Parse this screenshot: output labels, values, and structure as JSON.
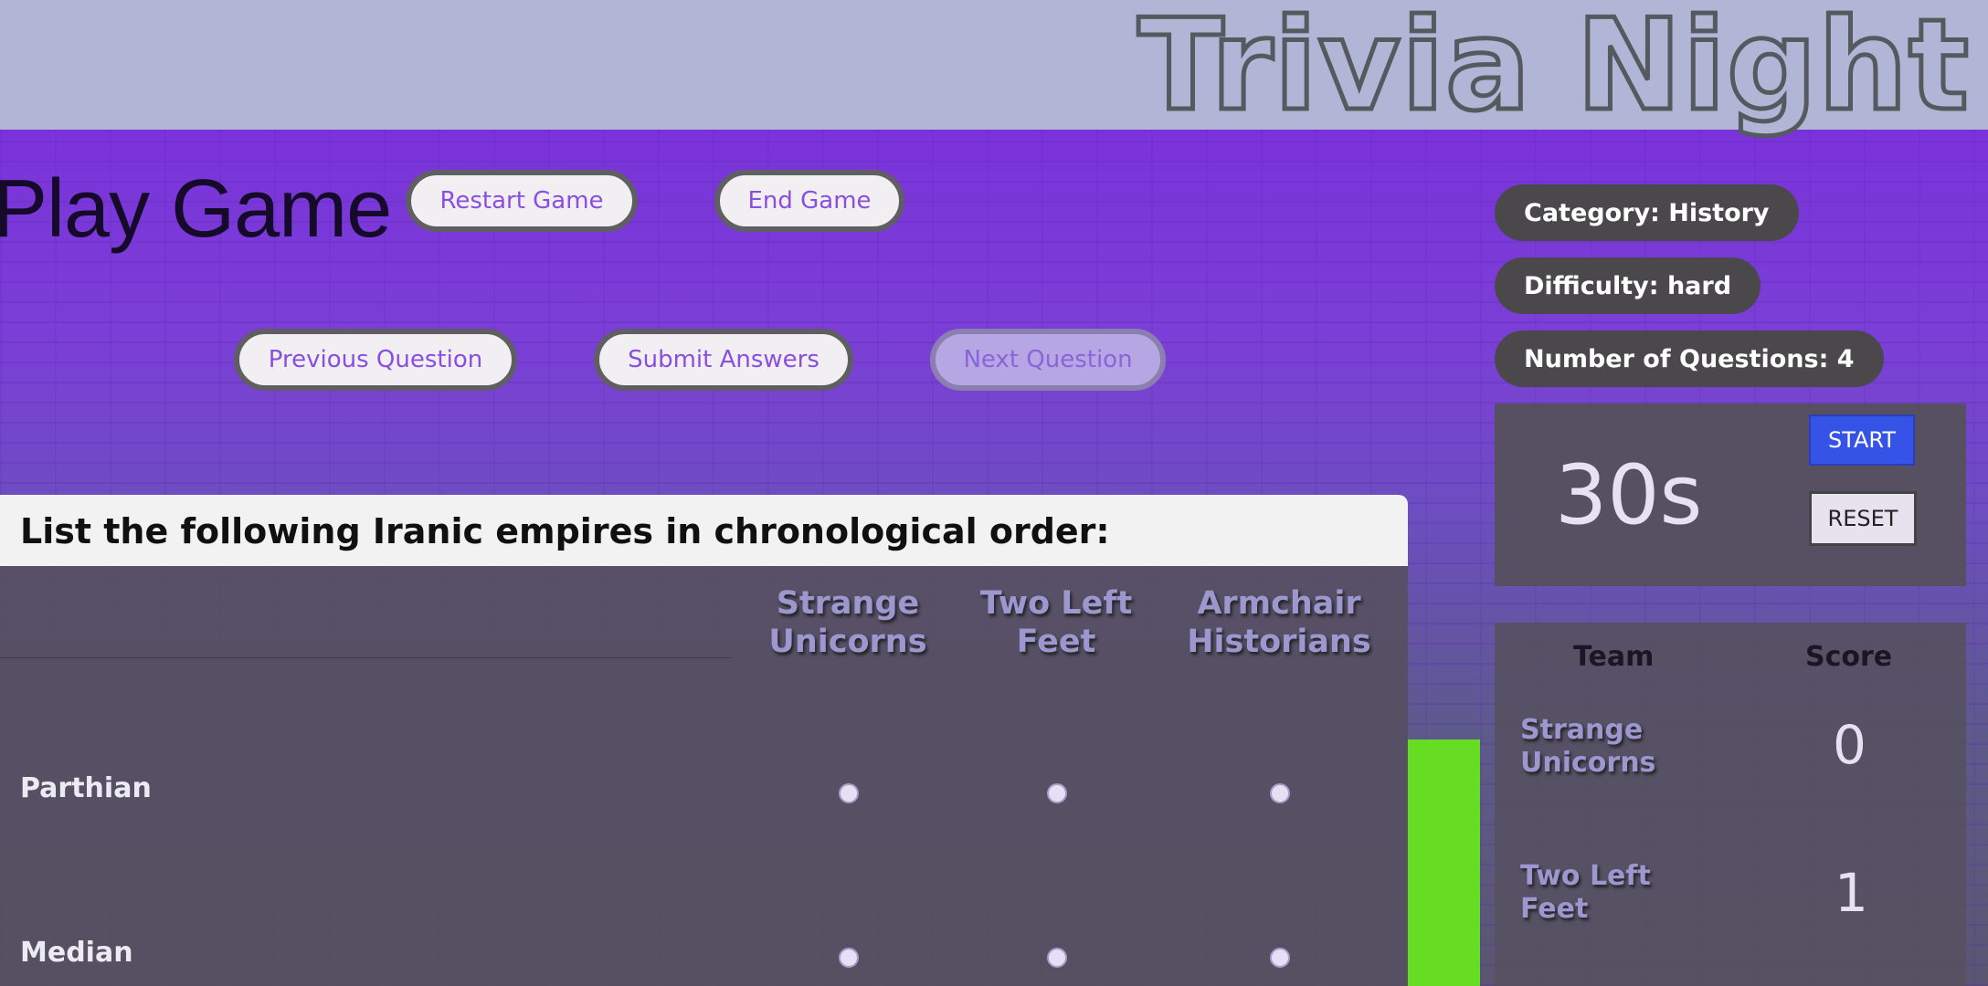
{
  "header": {
    "app_title": "Trivia Night"
  },
  "page": {
    "title": "Play Game"
  },
  "controls": {
    "restart": "Restart Game",
    "end": "End Game",
    "previous": "Previous Question",
    "submit": "Submit Answers",
    "next": "Next Question"
  },
  "game_info": {
    "category": "Category: History",
    "difficulty": "Difficulty: hard",
    "num_questions": "Number of Questions: 4"
  },
  "timer": {
    "value": "30s",
    "start_label": "START",
    "reset_label": "RESET"
  },
  "scoreboard": {
    "team_header": "Team",
    "score_header": "Score",
    "rows": [
      {
        "team": "Strange Unicorns",
        "score": "0"
      },
      {
        "team": "Two Left Feet",
        "score": "1"
      }
    ]
  },
  "question": {
    "text": "List the following Iranic empires in chronological order:",
    "teams": [
      "Strange Unicorns",
      "Two Left Feet",
      "Armchair Historians"
    ],
    "options": [
      "Parthian",
      "Median"
    ]
  },
  "colors": {
    "accent": "#8a4ee0",
    "stage_purple": "#7a33d9",
    "start_button": "#3553e6",
    "badge_bg": "#4a484a"
  }
}
